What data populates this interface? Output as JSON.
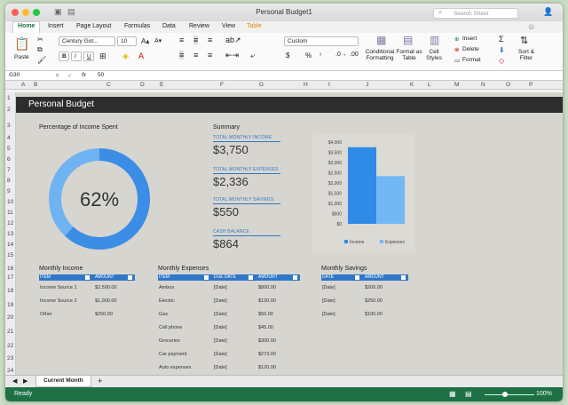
{
  "window": {
    "title": "Personal Budget1",
    "search_placeholder": "Search Sheet"
  },
  "tabs": [
    "Home",
    "Insert",
    "Page Layout",
    "Formulas",
    "Data",
    "Review",
    "View",
    "Table"
  ],
  "ribbon": {
    "paste": "Paste",
    "font_name": "Century Got...",
    "font_size": "10",
    "number_format": "Custom",
    "conditional": "Conditional Formatting",
    "format_table": "Format as Table",
    "cell_styles": "Cell Styles",
    "insert": "Insert",
    "delete": "Delete",
    "format": "Format",
    "sort_filter": "Sort & Filter",
    "bold": "B",
    "italic": "I",
    "underline": "U",
    "currency": "$",
    "percent": "%"
  },
  "formula_bar": {
    "cell_ref": "G30",
    "fx": "fx",
    "value": "50"
  },
  "columns": [
    "A",
    "B",
    "C",
    "D",
    "E",
    "F",
    "G",
    "H",
    "I",
    "J",
    "K",
    "L",
    "M",
    "N",
    "O",
    "P"
  ],
  "rows": [
    "1",
    "2",
    "3",
    "4",
    "5",
    "6",
    "7",
    "8",
    "9",
    "10",
    "11",
    "12",
    "13",
    "14",
    "15",
    "16",
    "17",
    "18",
    "19",
    "20",
    "21",
    "22",
    "23",
    "24"
  ],
  "sheet": {
    "title": "Personal Budget",
    "pct_label": "Percentage of Income Spent",
    "pct_value": "62%",
    "pct_fraction": 0.62,
    "summary_title": "Summary",
    "summary": [
      {
        "label": "TOTAL MONTHLY INCOME",
        "value": "$3,750"
      },
      {
        "label": "TOTAL MONTHLY EXPENSES",
        "value": "$2,336"
      },
      {
        "label": "TOTAL MONTHLY SAVINGS",
        "value": "$550"
      },
      {
        "label": "CASH BALANCE",
        "value": "$864"
      }
    ],
    "income": {
      "title": "Monthly Income",
      "headers": [
        "ITEM",
        "AMOUNT"
      ],
      "rows": [
        [
          "Income Source 1",
          "$2,500.00"
        ],
        [
          "Income Source 2",
          "$1,000.00"
        ],
        [
          "Other",
          "$250.00"
        ]
      ]
    },
    "expenses": {
      "title": "Monthly Expenses",
      "headers": [
        "ITEM",
        "DUE DATE",
        "AMOUNT"
      ],
      "rows": [
        [
          "Ambos",
          "[Date]",
          "$800.00"
        ],
        [
          "Electric",
          "[Date]",
          "$120.00"
        ],
        [
          "Gas",
          "[Date]",
          "$50.00"
        ],
        [
          "Cell phone",
          "[Date]",
          "$45.00"
        ],
        [
          "Groceries",
          "[Date]",
          "$300.00"
        ],
        [
          "Car payment",
          "[Date]",
          "$273.00"
        ],
        [
          "Auto expenses",
          "[Date]",
          "$120.00"
        ]
      ]
    },
    "savings": {
      "title": "Monthly Savings",
      "headers": [
        "DATE",
        "AMOUNT"
      ],
      "rows": [
        [
          "[Date]",
          "$200.00"
        ],
        [
          "[Date]",
          "$250.00"
        ],
        [
          "[Date]",
          "$100.00"
        ]
      ]
    }
  },
  "chart_data": [
    {
      "type": "pie",
      "values": [
        62,
        38
      ],
      "labels": [
        "",
        ""
      ],
      "center_label": "62%",
      "colors": [
        "#3b8de6",
        "#6fb3f2"
      ]
    },
    {
      "type": "bar",
      "categories": [
        "Income",
        "Expenses"
      ],
      "values": [
        3750,
        2336
      ],
      "ylim": [
        0,
        4000
      ],
      "yticks": [
        "$4,000",
        "$3,500",
        "$3,000",
        "$2,500",
        "$2,000",
        "$1,500",
        "$1,000",
        "$500",
        "$0"
      ],
      "legend": [
        "Income",
        "Expenses"
      ],
      "colors": [
        "#2f8be6",
        "#72b8f4"
      ],
      "legend_position": "bottom"
    }
  ],
  "sheet_tab": "Current Month",
  "status": {
    "text": "Ready",
    "zoom": "100%"
  },
  "colors": {
    "accent": "#207245",
    "header": "#2d2d2d",
    "table_header": "#2f77c8"
  }
}
